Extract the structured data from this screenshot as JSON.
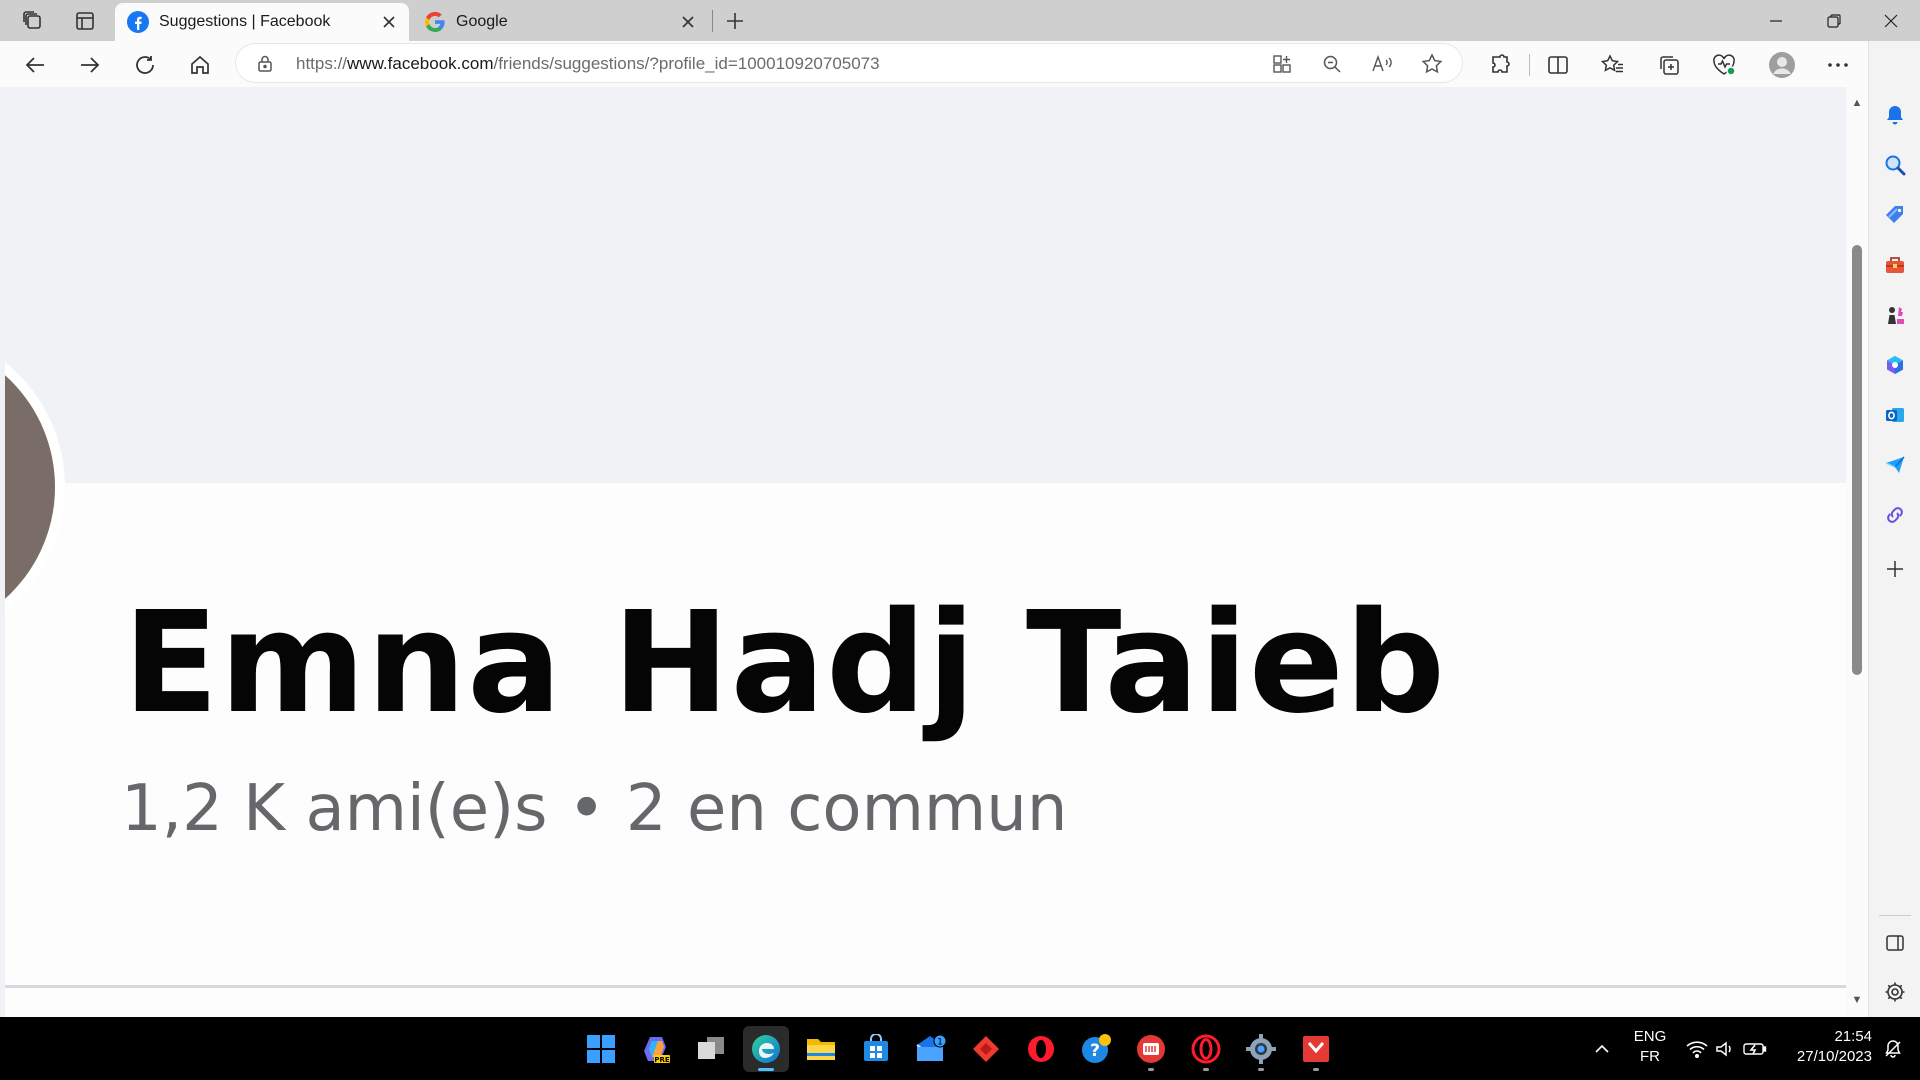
{
  "browser": {
    "tabs": [
      {
        "title": "Suggestions | Facebook",
        "active": true,
        "favicon": "facebook-icon"
      },
      {
        "title": "Google",
        "active": false,
        "favicon": "google-icon"
      }
    ],
    "address": {
      "prefix": "https://",
      "host": "www.facebook.com",
      "path": "/friends/suggestions/?profile_id=100010920705073"
    }
  },
  "profile": {
    "name": "Emna Hadj Taieb",
    "meta": "1,2 K ami(e)s • 2 en commun"
  },
  "taskbar": {
    "mail_badge": "1",
    "language": "ENG",
    "layout": "FR",
    "time": "21:54",
    "date": "27/10/2023"
  },
  "colors": {
    "facebook_blue": "#1877f2",
    "page_background": "#f0f2f5",
    "meta_text": "#65676b",
    "taskbar": "#000000",
    "edge_accent": "#4cc2ff"
  }
}
